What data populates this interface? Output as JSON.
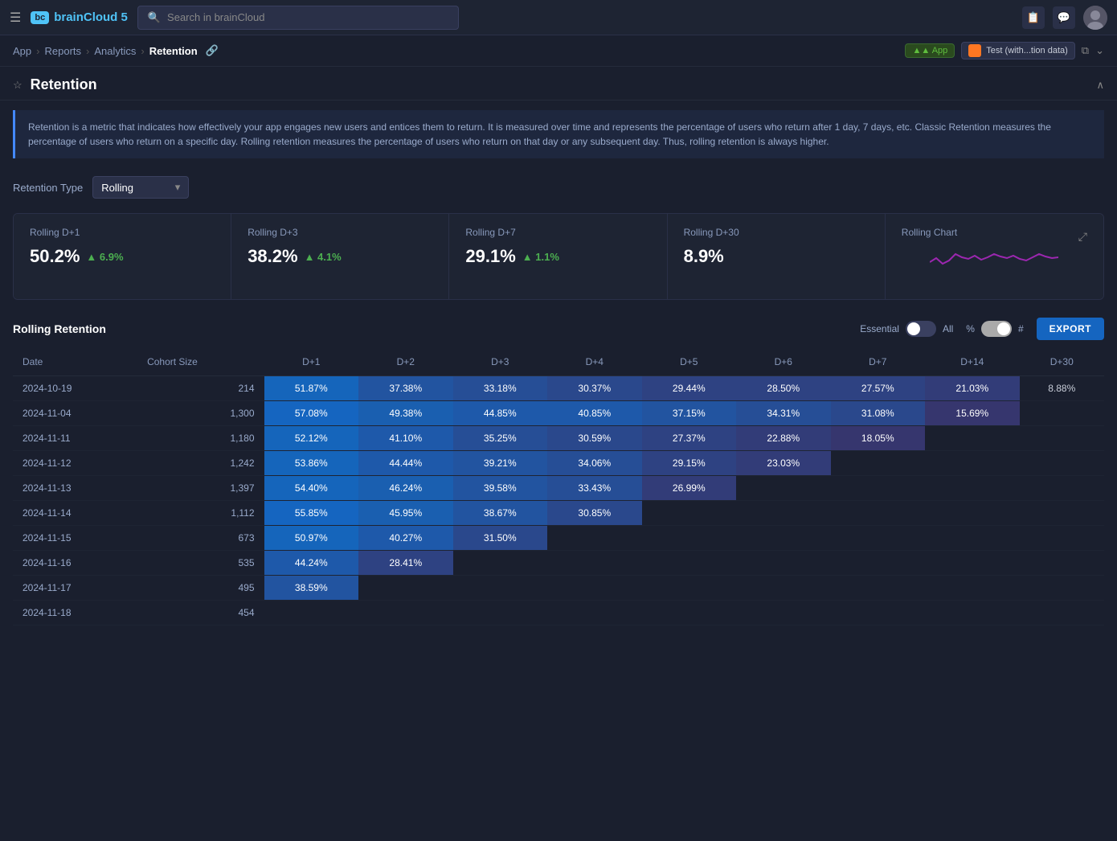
{
  "nav": {
    "hamburger": "☰",
    "logo_text": "brainCloud 5",
    "search_placeholder": "Search in brainCloud",
    "icons": [
      "📋",
      "💬"
    ],
    "env_label": "▲ App",
    "app_name": "Test (with...tion data)",
    "expand_icon": "⬍"
  },
  "breadcrumb": {
    "app": "App",
    "reports": "Reports",
    "analytics": "Analytics",
    "current": "Retention"
  },
  "page": {
    "title": "Retention",
    "info_text": "Retention is a metric that indicates how effectively your app engages new users and entices them to return. It is measured over time and represents the percentage of users who return after 1 day, 7 days, etc. Classic Retention measures the percentage of users who return on a specific day. Rolling retention measures the percentage of users who return on that day or any subsequent day. Thus, rolling retention is always higher."
  },
  "retention_type": {
    "label": "Retention Type",
    "selected": "Rolling"
  },
  "metrics": [
    {
      "title": "Rolling D+1",
      "value": "50.2%",
      "trend": "+6.9%",
      "trend_type": "up"
    },
    {
      "title": "Rolling D+3",
      "value": "38.2%",
      "trend": "+4.1%",
      "trend_type": "up"
    },
    {
      "title": "Rolling D+7",
      "value": "29.1%",
      "trend": "+1.1%",
      "trend_type": "up"
    },
    {
      "title": "Rolling D+30",
      "value": "8.9%",
      "trend": "",
      "trend_type": "none"
    },
    {
      "title": "Rolling Chart",
      "value": "",
      "is_chart": true
    }
  ],
  "table": {
    "section_title": "Rolling Retention",
    "toggle_left": "Essential",
    "toggle_right": "All",
    "toggle_pct": "%",
    "toggle_hash": "#",
    "export_label": "EXPORT",
    "columns": [
      "Date",
      "Cohort Size",
      "D+1",
      "D+2",
      "D+3",
      "D+4",
      "D+5",
      "D+6",
      "D+7",
      "D+14",
      "D+30"
    ],
    "rows": [
      {
        "date": "2024-10-19",
        "cohort": "214",
        "d1": "51.87%",
        "d2": "37.38%",
        "d3": "33.18%",
        "d4": "30.37%",
        "d5": "29.44%",
        "d6": "28.50%",
        "d7": "27.57%",
        "d14": "21.03%",
        "d30": "8.88%"
      },
      {
        "date": "2024-11-04",
        "cohort": "1,300",
        "d1": "57.08%",
        "d2": "49.38%",
        "d3": "44.85%",
        "d4": "40.85%",
        "d5": "37.15%",
        "d6": "34.31%",
        "d7": "31.08%",
        "d14": "15.69%",
        "d30": ""
      },
      {
        "date": "2024-11-11",
        "cohort": "1,180",
        "d1": "52.12%",
        "d2": "41.10%",
        "d3": "35.25%",
        "d4": "30.59%",
        "d5": "27.37%",
        "d6": "22.88%",
        "d7": "18.05%",
        "d14": "",
        "d30": ""
      },
      {
        "date": "2024-11-12",
        "cohort": "1,242",
        "d1": "53.86%",
        "d2": "44.44%",
        "d3": "39.21%",
        "d4": "34.06%",
        "d5": "29.15%",
        "d6": "23.03%",
        "d7": "",
        "d14": "",
        "d30": ""
      },
      {
        "date": "2024-11-13",
        "cohort": "1,397",
        "d1": "54.40%",
        "d2": "46.24%",
        "d3": "39.58%",
        "d4": "33.43%",
        "d5": "26.99%",
        "d6": "",
        "d7": "",
        "d14": "",
        "d30": ""
      },
      {
        "date": "2024-11-14",
        "cohort": "1,112",
        "d1": "55.85%",
        "d2": "45.95%",
        "d3": "38.67%",
        "d4": "30.85%",
        "d5": "",
        "d6": "",
        "d7": "",
        "d14": "",
        "d30": ""
      },
      {
        "date": "2024-11-15",
        "cohort": "673",
        "d1": "50.97%",
        "d2": "40.27%",
        "d3": "31.50%",
        "d4": "",
        "d5": "",
        "d6": "",
        "d7": "",
        "d14": "",
        "d30": ""
      },
      {
        "date": "2024-11-16",
        "cohort": "535",
        "d1": "44.24%",
        "d2": "28.41%",
        "d3": "",
        "d4": "",
        "d5": "",
        "d6": "",
        "d7": "",
        "d14": "",
        "d30": ""
      },
      {
        "date": "2024-11-17",
        "cohort": "495",
        "d1": "38.59%",
        "d2": "",
        "d3": "",
        "d4": "",
        "d5": "",
        "d6": "",
        "d7": "",
        "d14": "",
        "d30": ""
      },
      {
        "date": "2024-11-18",
        "cohort": "454",
        "d1": "",
        "d2": "",
        "d3": "",
        "d4": "",
        "d5": "",
        "d6": "",
        "d7": "",
        "d14": "",
        "d30": ""
      }
    ]
  },
  "sparkline_data": [
    40,
    45,
    38,
    42,
    50,
    46,
    44,
    48,
    43,
    46,
    50,
    47,
    45,
    48,
    44,
    42,
    46,
    50,
    47,
    45
  ]
}
